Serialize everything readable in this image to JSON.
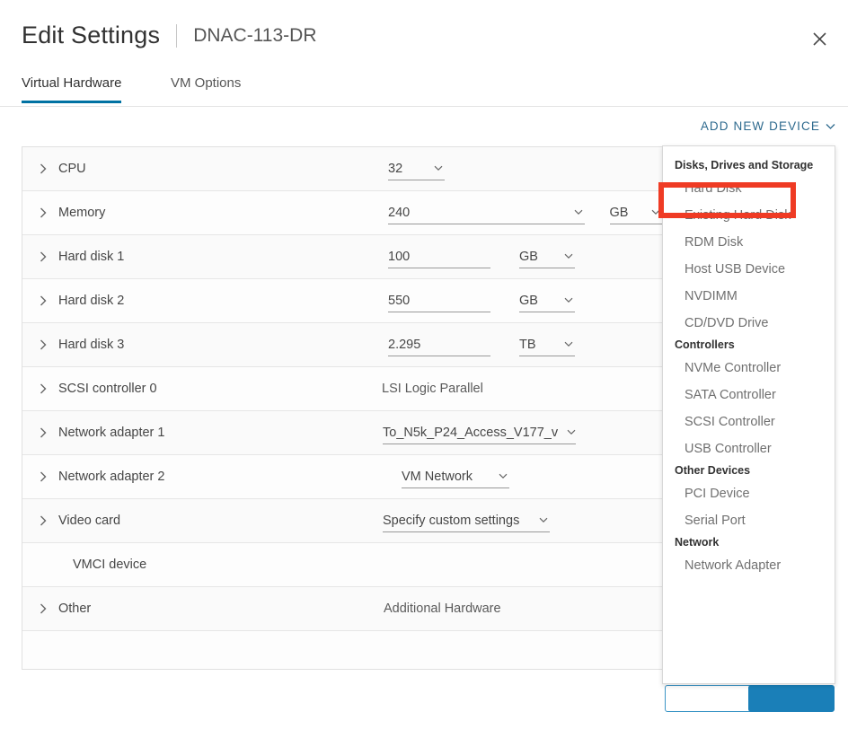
{
  "header": {
    "title": "Edit Settings",
    "vm_name": "DNAC-113-DR",
    "close_icon": "close-icon"
  },
  "tabs": [
    {
      "label": "Virtual Hardware",
      "active": true
    },
    {
      "label": "VM Options",
      "active": false
    }
  ],
  "toolbar": {
    "add_new_device_label": "ADD NEW DEVICE",
    "add_new_device_chevron": "chevron-down-icon",
    "link_color": "#2e6a8e"
  },
  "hardware": {
    "rows": [
      {
        "label": "CPU",
        "value": "32",
        "unit": ""
      },
      {
        "label": "Memory",
        "value": "240",
        "unit": "GB"
      },
      {
        "label": "Hard disk 1",
        "value": "100",
        "unit": "GB"
      },
      {
        "label": "Hard disk 2",
        "value": "550",
        "unit": "GB"
      },
      {
        "label": "Hard disk 3",
        "value": "2.295",
        "unit": "TB"
      },
      {
        "label": "SCSI controller 0",
        "value": "LSI Logic Parallel",
        "unit": ""
      },
      {
        "label": "Network adapter 1",
        "value": "To_N5k_P24_Access_V177_v",
        "unit": ""
      },
      {
        "label": "Network adapter 2",
        "value": "VM Network",
        "unit": ""
      },
      {
        "label": "Video card",
        "value": "Specify custom settings",
        "unit": ""
      },
      {
        "label": "VMCI device",
        "value": "",
        "unit": ""
      },
      {
        "label": "Other",
        "value": "Additional Hardware",
        "unit": ""
      }
    ]
  },
  "device_menu": {
    "groups": [
      {
        "header": "Disks, Drives and Storage",
        "items": [
          "Hard Disk",
          "Existing Hard Disk",
          "RDM Disk",
          "Host USB Device",
          "NVDIMM",
          "CD/DVD Drive"
        ]
      },
      {
        "header": "Controllers",
        "items": [
          "NVMe Controller",
          "SATA Controller",
          "SCSI Controller",
          "USB Controller"
        ]
      },
      {
        "header": "Other Devices",
        "items": [
          "PCI Device",
          "Serial Port"
        ]
      },
      {
        "header": "Network",
        "items": [
          "Network Adapter"
        ]
      }
    ],
    "highlighted_item": "Hard Disk",
    "highlight_color": "#ef3b24"
  },
  "footer": {
    "cancel_label": "",
    "ok_label": "",
    "ok_color": "#1a7fb8"
  }
}
